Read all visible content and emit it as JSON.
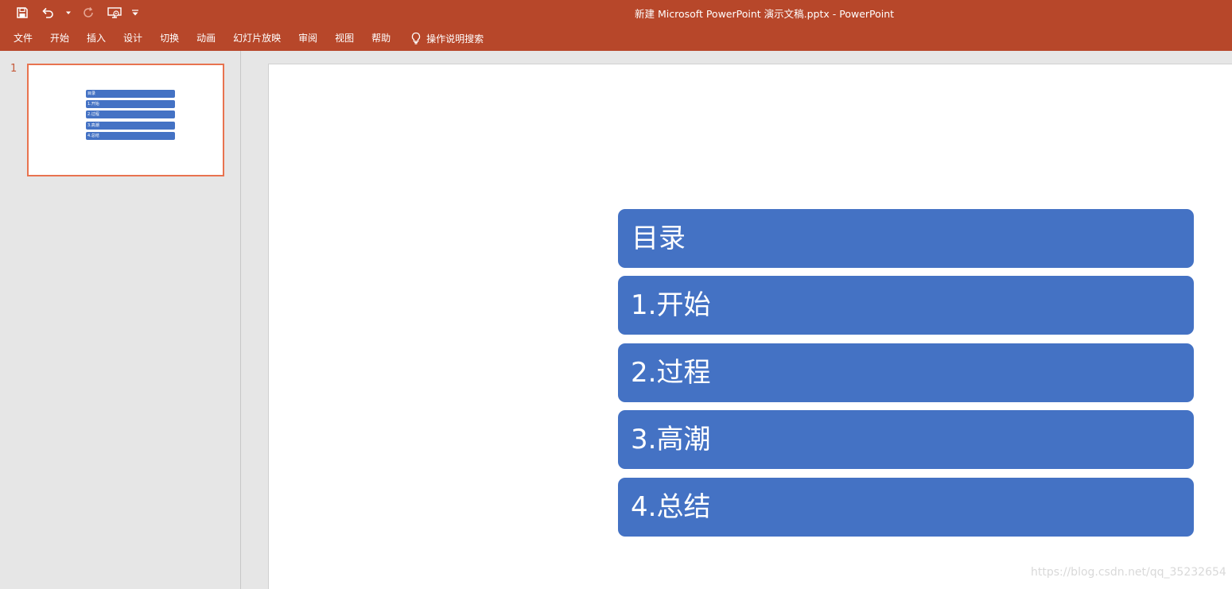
{
  "window": {
    "title": "新建 Microsoft PowerPoint 演示文稿.pptx  -  PowerPoint"
  },
  "quick_access": {
    "icons": [
      "save-icon",
      "undo-icon",
      "undo-dropdown-icon",
      "redo-icon",
      "present-from-start-icon",
      "customize-toolbar-icon"
    ]
  },
  "ribbon": {
    "tabs": [
      {
        "label": "文件"
      },
      {
        "label": "开始"
      },
      {
        "label": "插入"
      },
      {
        "label": "设计"
      },
      {
        "label": "切换"
      },
      {
        "label": "动画"
      },
      {
        "label": "幻灯片放映"
      },
      {
        "label": "审阅"
      },
      {
        "label": "视图"
      },
      {
        "label": "帮助"
      }
    ],
    "tell_me": {
      "icon": "lightbulb-icon",
      "label": "操作说明搜索"
    }
  },
  "thumbnails": [
    {
      "number": "1",
      "selected": true,
      "items": [
        "目录",
        "1.开始",
        "2.过程",
        "3.高潮",
        "4.总结"
      ]
    }
  ],
  "slide": {
    "items": [
      "目录",
      "1.开始",
      "2.过程",
      "3.高潮",
      "4.总结"
    ]
  },
  "colors": {
    "accent": "#b7472a",
    "box_fill": "#4472c4",
    "selection_border": "#e8734f"
  },
  "watermark": {
    "text": "https://blog.csdn.net/qq_35232654"
  }
}
